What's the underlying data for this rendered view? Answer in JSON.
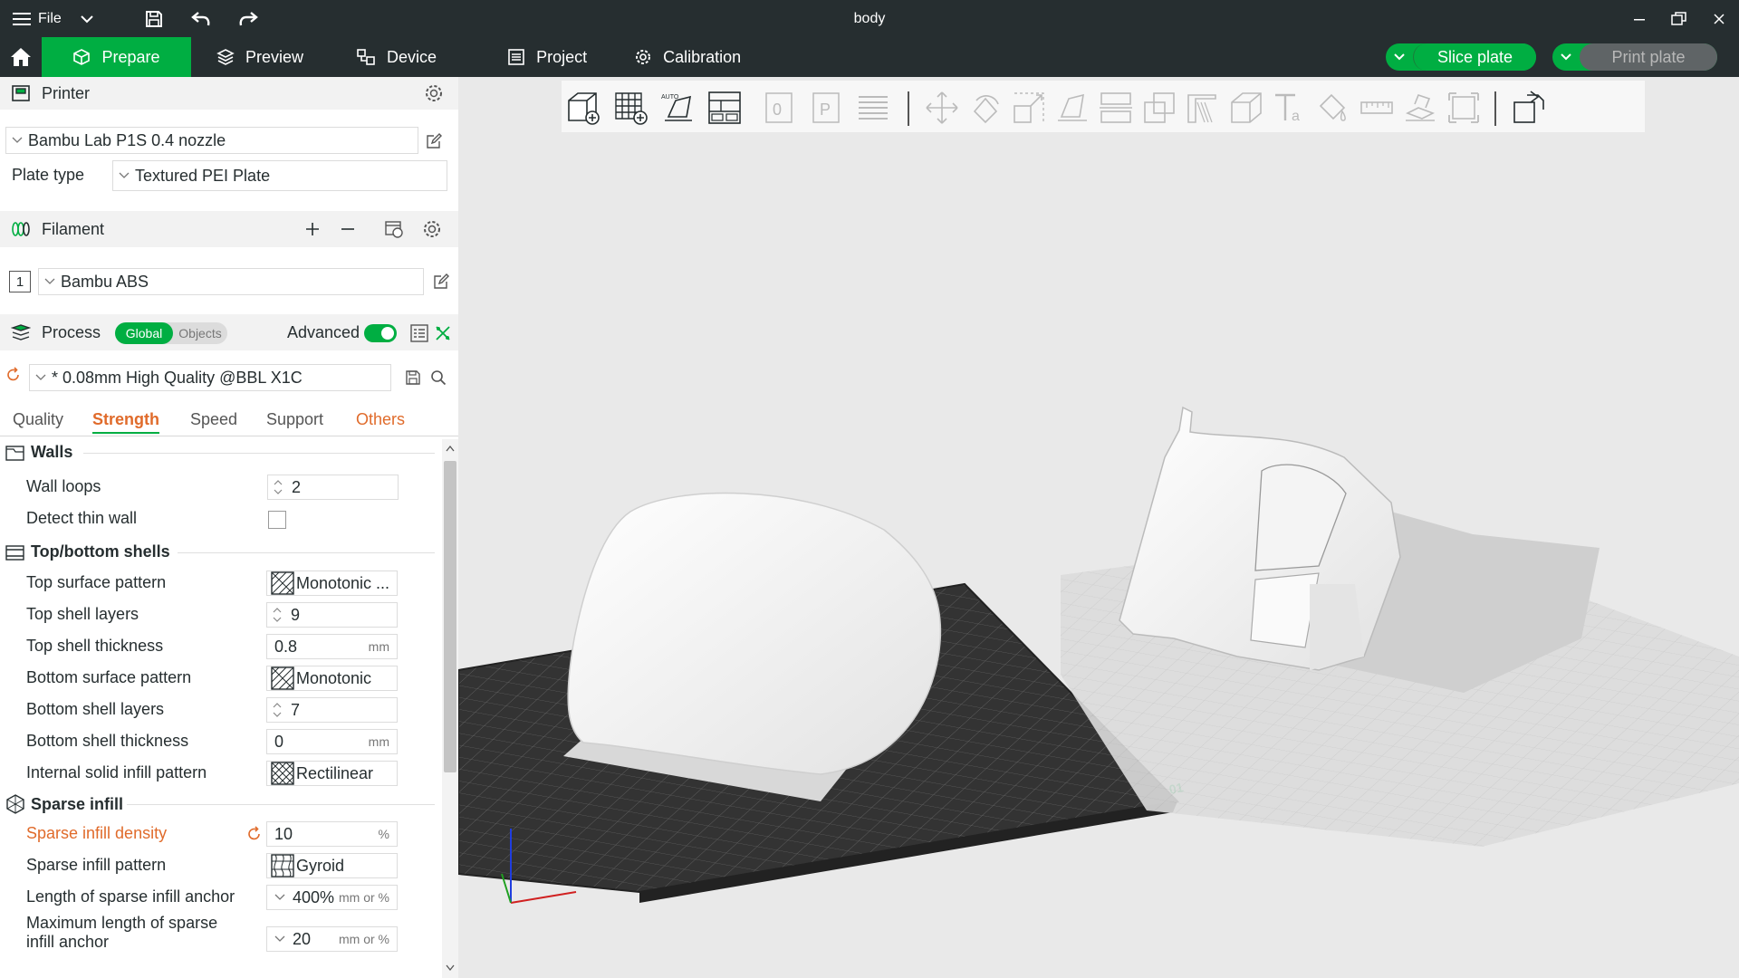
{
  "titlebar": {
    "file_label": "File",
    "doc_title": "body"
  },
  "tabs": {
    "prepare": "Prepare",
    "preview": "Preview",
    "device": "Device",
    "project": "Project",
    "calibration": "Calibration"
  },
  "actions": {
    "slice_plate": "Slice plate",
    "print_plate": "Print plate"
  },
  "printer": {
    "section_title": "Printer",
    "preset": "Bambu Lab P1S 0.4 nozzle",
    "plate_type_label": "Plate type",
    "plate_type": "Textured PEI Plate"
  },
  "filament": {
    "section_title": "Filament",
    "slot_number": "1",
    "preset": "Bambu ABS"
  },
  "process": {
    "section_title": "Process",
    "global_label": "Global",
    "objects_label": "Objects",
    "advanced_label": "Advanced",
    "preset": "* 0.08mm High Quality @BBL X1C",
    "tabs": [
      "Quality",
      "Strength",
      "Speed",
      "Support",
      "Others"
    ]
  },
  "settings": {
    "walls": {
      "title": "Walls",
      "wall_loops_label": "Wall loops",
      "wall_loops_value": "2",
      "detect_thin_wall_label": "Detect thin wall"
    },
    "shells": {
      "title": "Top/bottom shells",
      "top_surface_pattern_label": "Top surface pattern",
      "top_surface_pattern_value": "Monotonic ...",
      "top_shell_layers_label": "Top shell layers",
      "top_shell_layers_value": "9",
      "top_shell_thickness_label": "Top shell thickness",
      "top_shell_thickness_value": "0.8",
      "bottom_surface_pattern_label": "Bottom surface pattern",
      "bottom_surface_pattern_value": "Monotonic",
      "bottom_shell_layers_label": "Bottom shell layers",
      "bottom_shell_layers_value": "7",
      "bottom_shell_thickness_label": "Bottom shell thickness",
      "bottom_shell_thickness_value": "0",
      "internal_solid_infill_pattern_label": "Internal solid infill pattern",
      "internal_solid_infill_pattern_value": "Rectilinear",
      "unit_mm": "mm"
    },
    "infill": {
      "title": "Sparse infill",
      "density_label": "Sparse infill density",
      "density_value": "10",
      "density_unit": "%",
      "pattern_label": "Sparse infill pattern",
      "pattern_value": "Gyroid",
      "anchor_label": "Length of sparse infill anchor",
      "anchor_value": "400%",
      "anchor_unit": "mm or %",
      "max_anchor_label_1": "Maximum length of sparse",
      "max_anchor_label_2": "infill anchor",
      "max_anchor_value": "20",
      "max_anchor_unit": "mm or %"
    }
  },
  "plate": {
    "plate_number": "01"
  },
  "colors": {
    "accent": "#00ae42",
    "dark": "#262e30",
    "modified": "#e06b2b"
  }
}
